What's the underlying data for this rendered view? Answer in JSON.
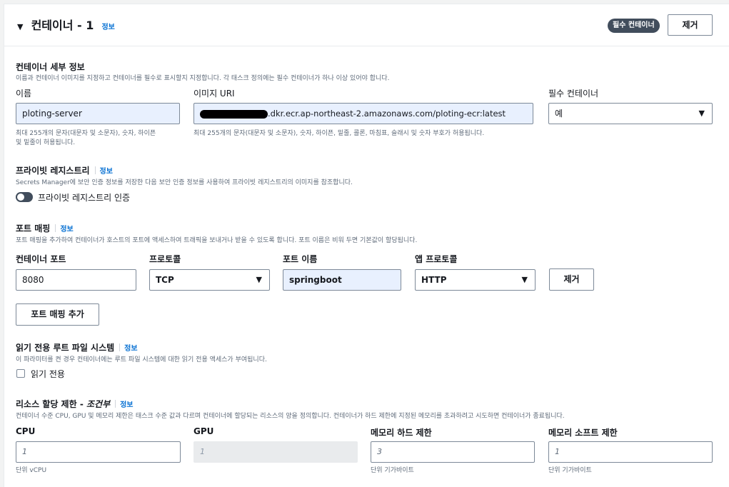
{
  "header": {
    "title": "컨테이너 - 1",
    "info": "정보",
    "essential_badge": "필수 컨테이너",
    "remove_label": "제거"
  },
  "details": {
    "title": "컨테이너 세부 정보",
    "desc": "이름과 컨테이너 이미지를 지정하고 컨테이너를 필수로 표시할지 지정합니다. 각 태스크 정의에는 필수 컨테이너가 하나 이상 있어야 합니다.",
    "name_label": "이름",
    "name_value": "ploting-server",
    "name_hint_1": "최대 255개의 문자(대문자 및 소문자), 숫자, 하이픈",
    "name_hint_2": "및 밑줄이 허용됩니다.",
    "image_label": "이미지 URI",
    "image_value_suffix": ".dkr.ecr.ap-northeast-2.amazonaws.com/ploting-ecr:latest",
    "image_hint": "최대 255개의 문자(대문자 및 소문자), 숫자, 하이픈, 밑줄, 콜론, 마침표, 슬래시 및 숫자 부호가 허용됩니다.",
    "essential_label": "필수 컨테이너",
    "essential_value": "예"
  },
  "private_registry": {
    "title": "프라이빗 레지스트리",
    "info": "정보",
    "desc": "Secrets Manager에 보안 인증 정보를 저장한 다음 보안 인증 정보를 사용하여 프라이빗 레지스트리의 이미지를 참조합니다.",
    "toggle_label": "프라이빗 레지스트리 인증"
  },
  "port_mapping": {
    "title": "포트 매핑",
    "info": "정보",
    "desc": "포트 매핑을 추가하여 컨테이너가 호스트의 포트에 액세스하여 트래픽을 보내거나 받을 수 있도록 합니다. 포트 이름은 비워 두면 기본값이 할당됩니다.",
    "container_port_label": "컨테이너 포트",
    "container_port_value": "8080",
    "protocol_label": "프로토콜",
    "protocol_value": "TCP",
    "port_name_label": "포트 이름",
    "port_name_value": "springboot",
    "app_protocol_label": "앱 프로토콜",
    "app_protocol_value": "HTTP",
    "remove_label": "제거",
    "add_label": "포트 매핑 추가"
  },
  "readonly_fs": {
    "title": "읽기 전용 루트 파일 시스템",
    "info": "정보",
    "desc": "이 파라미터를 켠 경우 컨테이너에는 루트 파일 시스템에 대한 읽기 전용 액세스가 부여됩니다.",
    "checkbox_label": "읽기 전용"
  },
  "resources": {
    "title": "리소스 할당 제한 - ",
    "title_italic": "조건부",
    "info": "정보",
    "desc": "컨테이너 수준 CPU, GPU 및 메모리 제한은 태스크 수준 값과 다르며 컨테이너에 할당되는 리소스의 양을 정의합니다. 컨테이너가 하드 제한에 지정된 메모리를 초과하려고 시도하면 컨테이너가 종료됩니다.",
    "cpu_label": "CPU",
    "cpu_placeholder": "1",
    "cpu_hint": "단위 vCPU",
    "gpu_label": "GPU",
    "gpu_placeholder": "1",
    "mem_hard_label": "메모리 하드 제한",
    "mem_hard_placeholder": "3",
    "mem_hard_hint": "단위 기가바이트",
    "mem_soft_label": "메모리 소프트 제한",
    "mem_soft_placeholder": "1",
    "mem_soft_hint": "단위 기가바이트"
  },
  "icons": {
    "collapse": "caret-down-icon",
    "select": "triangle-down-icon",
    "toggle": "toggle-off-icon",
    "checkbox": "checkbox-icon"
  },
  "colors": {
    "link": "#0972d3",
    "badge": "#414d5c",
    "filled_input": "#e8f0fe"
  }
}
